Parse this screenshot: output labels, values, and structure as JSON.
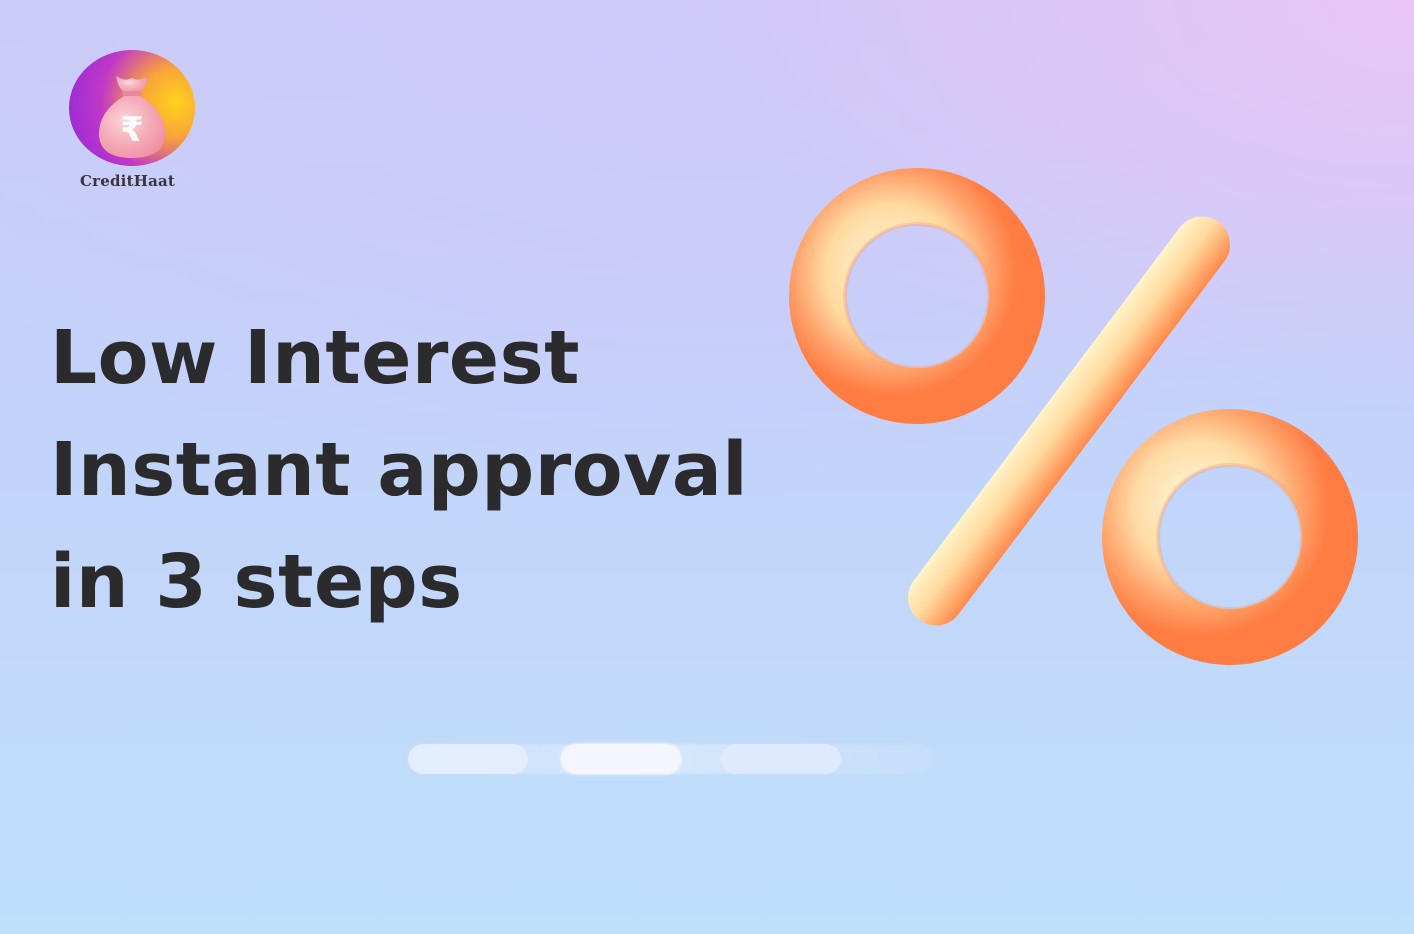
{
  "brand": {
    "name": "CreditHaat",
    "logo_symbol": "₹",
    "colors": {
      "logo_purple": "#8a26d8",
      "logo_yellow": "#ffd21a",
      "bag_pink": "#f4a7b5",
      "percent_orange": "#ff8a4c",
      "percent_cream": "#fff3c4"
    }
  },
  "hero": {
    "line1": "Low Interest",
    "line2": "Instant approval",
    "line3": "in 3 steps",
    "text_color": "#2b2b2d"
  },
  "graphic": {
    "icon": "percent-icon"
  },
  "carousel": {
    "slide_count": 3,
    "active_index": 2
  }
}
